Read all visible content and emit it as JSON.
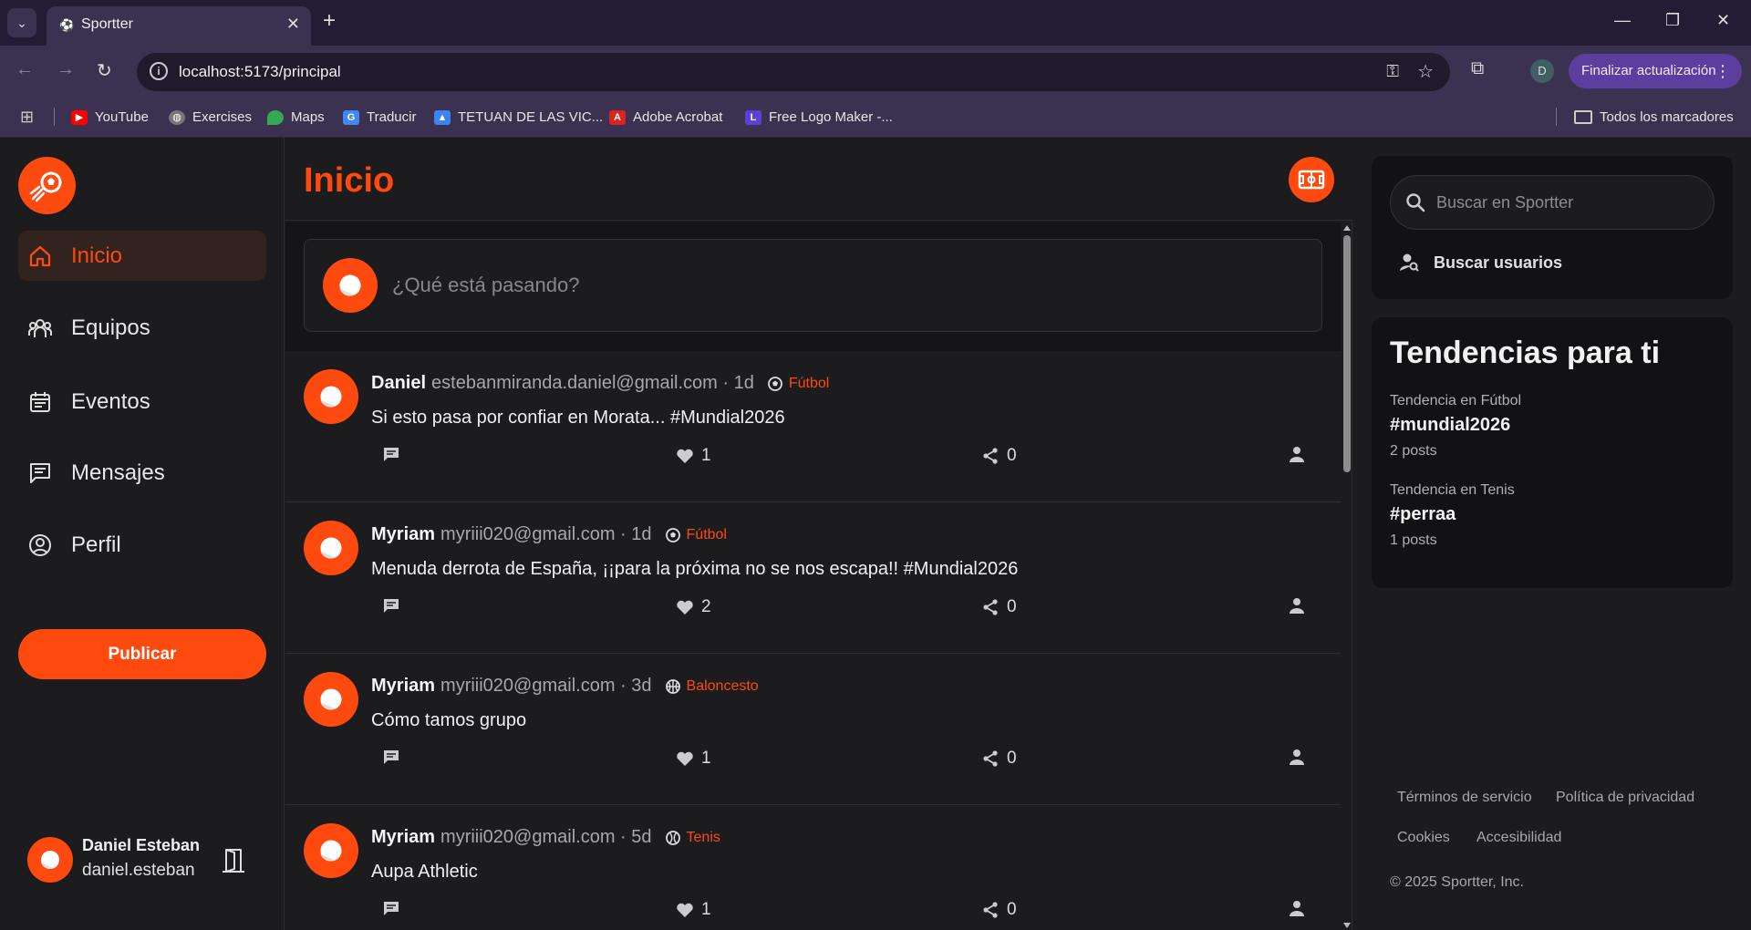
{
  "browser": {
    "tab_title": "Sportter",
    "url": "localhost:5173/principal",
    "profile_initial": "D",
    "update_label": "Finalizar actualización",
    "bookmarks": [
      {
        "label": "YouTube",
        "icon": "youtube-icon",
        "color": "#ff0000"
      },
      {
        "label": "Exercises",
        "icon": "globe-icon",
        "color": "#888888"
      },
      {
        "label": "Maps",
        "icon": "maps-pin-icon",
        "color": "#34a853"
      },
      {
        "label": "Traducir",
        "icon": "translate-icon",
        "color": "#4285f4"
      },
      {
        "label": "TETUAN DE LAS VIC...",
        "icon": "graduation-cap-icon",
        "color": "#3b82f6"
      },
      {
        "label": "Adobe Acrobat",
        "icon": "acrobat-icon",
        "color": "#d9251d"
      },
      {
        "label": "Free Logo Maker -...",
        "icon": "logo-maker-icon",
        "color": "#5b3fd6"
      }
    ],
    "all_bookmarks_label": "Todos los marcadores"
  },
  "sidebar": {
    "items": [
      {
        "label": "Inicio",
        "icon": "home-icon",
        "active": true
      },
      {
        "label": "Equipos",
        "icon": "team-icon",
        "active": false
      },
      {
        "label": "Eventos",
        "icon": "calendar-icon",
        "active": false
      },
      {
        "label": "Mensajes",
        "icon": "message-icon",
        "active": false
      },
      {
        "label": "Perfil",
        "icon": "user-circle-icon",
        "active": false
      }
    ],
    "publish_label": "Publicar",
    "user": {
      "name": "Daniel Esteban",
      "email": "daniel.esteban"
    }
  },
  "main": {
    "title": "Inicio",
    "compose_placeholder": "¿Qué está pasando?",
    "posts": [
      {
        "author": "Daniel",
        "meta": "estebanmiranda.daniel@gmail.com · 1d",
        "sport": "Fútbol",
        "sport_icon": "soccer-ball-icon",
        "text": "Si esto pasa por confiar en Morata... #Mundial2026",
        "likes": "1",
        "shares": "0"
      },
      {
        "author": "Myriam",
        "meta": "myriii020@gmail.com · 1d",
        "sport": "Fútbol",
        "sport_icon": "soccer-ball-icon",
        "text": "Menuda derrota de España, ¡¡para la próxima no se nos escapa!! #Mundial2026",
        "likes": "2",
        "shares": "0"
      },
      {
        "author": "Myriam",
        "meta": "myriii020@gmail.com · 3d",
        "sport": "Baloncesto",
        "sport_icon": "basketball-icon",
        "text": "Cómo tamos grupo",
        "likes": "1",
        "shares": "0"
      },
      {
        "author": "Myriam",
        "meta": "myriii020@gmail.com · 5d",
        "sport": "Tenis",
        "sport_icon": "tennis-ball-icon",
        "text": "Aupa Athletic",
        "likes": "1",
        "shares": "0"
      }
    ]
  },
  "right": {
    "search_placeholder": "Buscar en Sportter",
    "search_users_label": "Buscar usuarios",
    "trends_title": "Tendencias para ti",
    "trends": [
      {
        "category": "Tendencia en Fútbol",
        "tag": "#mundial2026",
        "count": "2 posts"
      },
      {
        "category": "Tendencia en Tenis",
        "tag": "#perraa",
        "count": "1 posts"
      }
    ],
    "footer": {
      "terms": "Términos de servicio",
      "privacy": "Política de privacidad",
      "cookies": "Cookies",
      "accessibility": "Accesibilidad",
      "copyright": "© 2025 Sportter, Inc."
    }
  },
  "colors": {
    "accent": "#ff4a0f",
    "background": "#1c1b1e",
    "card": "#121214"
  }
}
